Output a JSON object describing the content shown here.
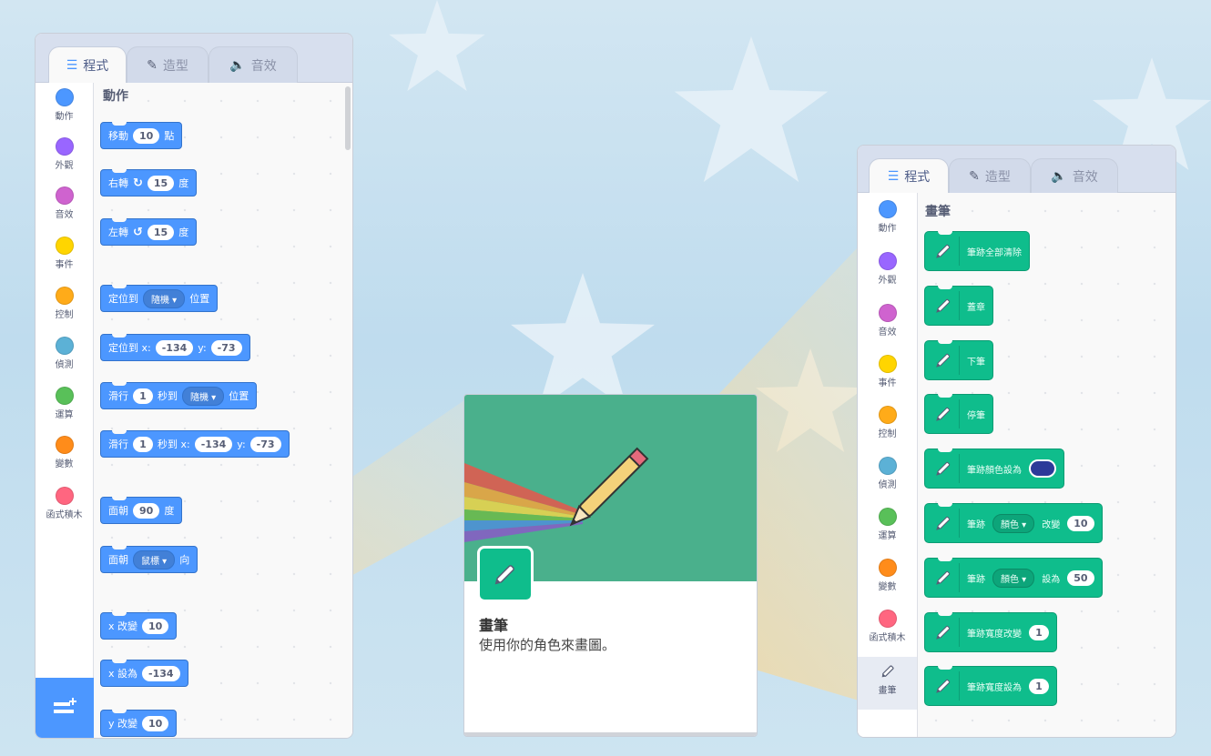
{
  "tabs": {
    "code": "程式",
    "costumes": "造型",
    "sounds": "音效"
  },
  "categories": [
    {
      "label": "動作",
      "color": "#4c97ff"
    },
    {
      "label": "外觀",
      "color": "#9966ff"
    },
    {
      "label": "音效",
      "color": "#cf63cf"
    },
    {
      "label": "事件",
      "color": "#ffd500"
    },
    {
      "label": "控制",
      "color": "#ffab19"
    },
    {
      "label": "偵測",
      "color": "#5cb1d6"
    },
    {
      "label": "運算",
      "color": "#59c059"
    },
    {
      "label": "變數",
      "color": "#ff8c1a"
    },
    {
      "label": "函式積木",
      "color": "#ff6680"
    },
    {
      "label": "畫筆",
      "color": "#0fbd8c"
    }
  ],
  "motion": {
    "title": "動作",
    "move": {
      "a": "移動",
      "v": "10",
      "b": "點"
    },
    "turn_right": {
      "a": "右轉",
      "v": "15",
      "b": "度"
    },
    "turn_left": {
      "a": "左轉",
      "v": "15",
      "b": "度"
    },
    "goto_random": {
      "a": "定位到",
      "menu": "隨機 ▾",
      "b": "位置"
    },
    "goto_xy": {
      "a": "定位到 x:",
      "x": "-134",
      "yl": "y:",
      "y": "-73"
    },
    "glide_random": {
      "a": "滑行",
      "v": "1",
      "b": "秒到",
      "menu": "隨機 ▾",
      "c": "位置"
    },
    "glide_xy": {
      "a": "滑行",
      "v": "1",
      "b": "秒到 x:",
      "x": "-134",
      "yl": "y:",
      "y": "-73"
    },
    "point_dir": {
      "a": "面朝",
      "v": "90",
      "b": "度"
    },
    "point_towards": {
      "a": "面朝",
      "menu": "鼠標 ▾",
      "b": "向"
    },
    "change_x": {
      "a": "x 改變",
      "v": "10"
    },
    "set_x": {
      "a": "x 設為",
      "v": "-134"
    },
    "change_y": {
      "a": "y 改變",
      "v": "10"
    }
  },
  "pen": {
    "title": "畫筆",
    "erase_all": "筆跡全部清除",
    "stamp": "蓋章",
    "pen_down": "下筆",
    "pen_up": "停筆",
    "set_color": "筆跡顏色設為",
    "change_param": {
      "a": "筆跡",
      "menu": "顏色 ▾",
      "b": "改變",
      "v": "10"
    },
    "set_param": {
      "a": "筆跡",
      "menu": "顏色 ▾",
      "b": "設為",
      "v": "50"
    },
    "change_size": {
      "a": "筆跡寬度改變",
      "v": "1"
    },
    "set_size": {
      "a": "筆跡寬度設為",
      "v": "1"
    }
  },
  "extension_card": {
    "title": "畫筆",
    "description": "使用你的角色來畫圖。"
  }
}
